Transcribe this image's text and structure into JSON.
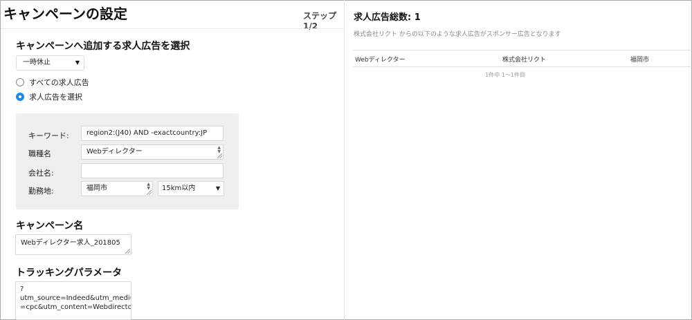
{
  "header": {
    "title": "キャンペーンの設定",
    "step": "ステップ1/2"
  },
  "campaign_target": {
    "heading": "キャンペーンへ追加する求人広告を選択",
    "status_select": "一時休止",
    "radio_options": [
      {
        "label": "すべての求人広告",
        "checked": false
      },
      {
        "label": "求人広告を選択",
        "checked": true
      }
    ]
  },
  "filters": {
    "keyword_label": "キーワード:",
    "keyword_value": "region2:(J40) AND -exactcountry:JP",
    "job_title_label": "職種名",
    "job_title_value": "Webディレクター",
    "company_label": "会社名:",
    "company_value": "",
    "location_label": "勤務地:",
    "location_value": "福岡市",
    "distance_value": "15km以内"
  },
  "campaign_name": {
    "heading": "キャンペーン名",
    "value": "Webディレクター求人_201805"
  },
  "tracking": {
    "heading": "トラッキングパラメータ",
    "lines": [
      "?",
      "utm_source=Indeed&utm_medium",
      "=cpc&utm_content=Webdirector"
    ]
  },
  "results": {
    "total_label": "求人広告総数: 1",
    "sponsor_note": "株式会社リクト からの以下のような求人広告がスポンサー広告となります",
    "columns": [
      "Webディレクター",
      "株式会社リクト",
      "福岡市"
    ],
    "pagination": "1件中 1〜1件目"
  }
}
